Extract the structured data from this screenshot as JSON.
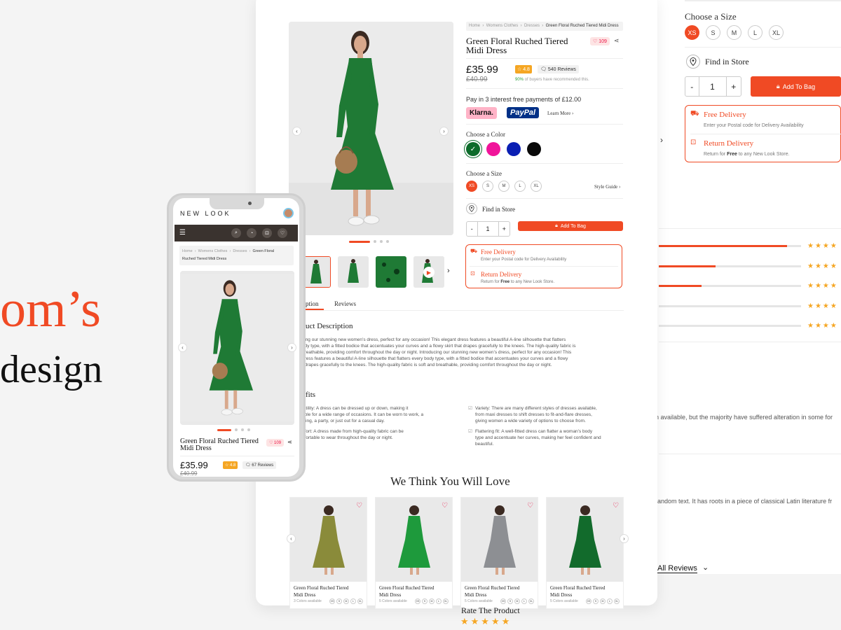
{
  "hero": {
    "line1": "om’s",
    "line2": "design"
  },
  "back": {
    "choose_size": "Choose a Size",
    "sizes": [
      "XS",
      "S",
      "M",
      "L",
      "XL"
    ],
    "find_in_store": "Find in Store",
    "qty_minus": "-",
    "qty_value": "1",
    "qty_plus": "+",
    "add_to_bag": "Add To Bag",
    "free_delivery": "Free Delivery",
    "free_delivery_sub": "Enter your Postal code for Delivery Availability",
    "return_delivery": "Return Delivery",
    "return_pre": "Return for ",
    "return_free": "Free",
    "return_post": " to any New Look Store.",
    "rating_fills": [
      0.9,
      0.4,
      0.3,
      0,
      0
    ],
    "stars": "★★★★",
    "text1": "n available, but the majority have suffered alteration in some for",
    "text2": "random text. It has roots in a piece of classical Latin literature fr",
    "all_reviews": "All Reviews",
    "rate_product": "Rate The Product",
    "rate_stars": "★★★★★"
  },
  "product": {
    "breadcrumb": [
      "Home",
      "Womens Clothes",
      "Dresses",
      "Green Floral Ruched Tiered Midi Dress"
    ],
    "title_line1": "Green Floral Ruched Tiered",
    "title_line2": "Midi Dress",
    "likes": "♡ 109",
    "price": "£35.99",
    "old_price": "£40.99",
    "rating": "☆ 4.8",
    "reviews": "540 Reviews",
    "recommend_pct": "90%",
    "recommend_text": " of buyers have recommended this.",
    "pay_in_3": "Pay in 3 interest free payments of £12.00",
    "klarna": "Klarna.",
    "paypal": "PayPal",
    "learn_more": "Learn More ›",
    "choose_color": "Choose a Color",
    "colors": [
      "#0c6b2a",
      "#f0149a",
      "#0a1fb3",
      "#0a0a0a"
    ],
    "choose_size": "Choose a Size",
    "sizes": [
      "XS",
      "S",
      "M",
      "L",
      "XL"
    ],
    "style_guide": "Style Guide ›",
    "find_in_store": "Find in Store",
    "qty_minus": "-",
    "qty_value": "1",
    "qty_plus": "+",
    "add_to_bag": "Add To Bag",
    "free_delivery": "Free Delivery",
    "free_delivery_sub": "Enter your Postal code for Delivery Availability",
    "return_delivery": "Return Delivery",
    "return_pre": "Return for ",
    "return_free": "Free",
    "return_post": " to any New Look Store.",
    "tab_description": "ption",
    "tab_reviews": "Reviews",
    "desc_title": "uct Description",
    "desc_lines": [
      "cing our stunning new women’s dress, perfect for any occasion! This elegant dress features a beautiful A-line silhouette that flatters",
      "ody type, with a fitted bodice that accentuates your curves and a flowy skirt that drapes gracefully to the knees. The high-quality fabric is",
      "breathable, providing comfort throughout the day or night. Introducing our stunning new women’s dress, perfect for any occasion! This",
      "dress features a beautiful A-line silhouette that flatters every body type, with a fitted bodice that accentuates your curves and a flowy",
      "t drapes gracefully to the knees. The high-quality fabric is soft and breathable, providing comfort throughout the day or night."
    ],
    "benefits_title": "fits",
    "benefits_left": [
      [
        "tatility: A dress can be dressed up or down, making it",
        "able for a wide range of occasions. It can be worn to work, a",
        "lding, a party, or just out for a casual day."
      ],
      [
        "nfort: A dress made from high-quality fabric can be",
        "nfortable to wear throughout the day or night."
      ]
    ],
    "benefits_right": [
      [
        "Variety: There are many different styles of dresses available,",
        "from maxi dresses to shift dresses to fit-and-flare dresses,",
        "giving women a wide variety of options to choose from."
      ],
      [
        "Flattering fit: A well-fitted dress can flatter a woman’s body",
        "type and accentuate her curves, making her feel confident and",
        "beautiful."
      ]
    ]
  },
  "recommend": {
    "title": "We Think You Will Love",
    "cards": [
      {
        "line1": "Green Floral Ruched Tiered",
        "line2": "Midi Dress",
        "colors": "3 Colors available",
        "dress": "#8a8b3a"
      },
      {
        "line1": "Green Floral Ruched Tiered",
        "line2": "Midi Dress",
        "colors": "5 Colors available",
        "dress": "#1e9a3c"
      },
      {
        "line1": "Green Floral Ruched Tiered",
        "line2": "Midi Dress",
        "colors": "5 Colors available",
        "dress": "#8d8f93"
      },
      {
        "line1": "Green Floral Ruched Tiered",
        "line2": "Midi Dress",
        "colors": "5 Colors available",
        "dress": "#126b2c"
      }
    ],
    "sizes": [
      "XS",
      "S",
      "M",
      "L",
      "XL"
    ]
  },
  "phone": {
    "brand": "NEW LOOK",
    "breadcrumb": [
      "Home",
      "Womens Clothes",
      "Dresses",
      "Green Floral"
    ],
    "breadcrumb_line2": "Ruched Tiered Midi Dress",
    "title_line1": "Green Floral Ruched Tiered",
    "title_line2": "Midi Dress",
    "likes": "♡ 109",
    "price": "£35.99",
    "old_price": "£40.99",
    "rating": "☆ 4.8",
    "reviews": "67 Reviews"
  },
  "colors": {
    "accent": "#f04a24",
    "dark_nav": "#3a332f"
  }
}
